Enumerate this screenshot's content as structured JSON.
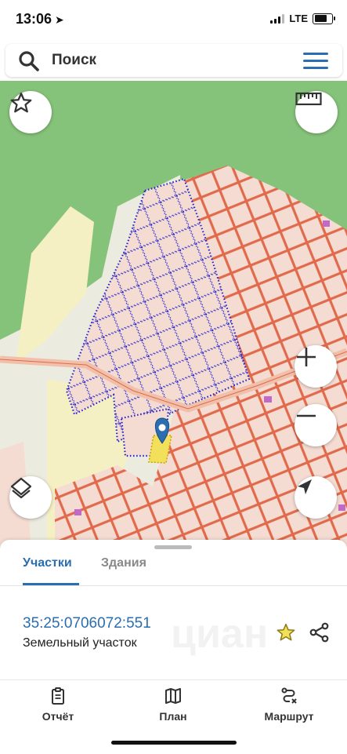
{
  "status_bar": {
    "time": "13:06",
    "network": "LTE",
    "battery_level": 0.7
  },
  "search": {
    "placeholder": "Поиск"
  },
  "map": {
    "icons": [
      "star-icon",
      "ruler-icon",
      "zoom-in-icon",
      "zoom-out-icon",
      "layers-icon",
      "locate-icon",
      "map-pin-icon"
    ]
  },
  "sheet": {
    "tabs": [
      {
        "label": "Участки",
        "active": true
      },
      {
        "label": "Здания",
        "active": false
      }
    ],
    "parcel": {
      "id": "35:25:0706072:551",
      "type": "Земельный участок"
    }
  },
  "tabbar": {
    "items": [
      {
        "label": "Отчёт",
        "icon": "report-icon"
      },
      {
        "label": "План",
        "icon": "map-book-icon"
      },
      {
        "label": "Маршрут",
        "icon": "route-icon"
      }
    ]
  },
  "colors": {
    "accent": "#2a6db0",
    "forest": "#86c37a",
    "parcel_border": "#e06a4b",
    "planned_parcels": "#2222cc",
    "selected_parcel": "#f3e05a"
  }
}
